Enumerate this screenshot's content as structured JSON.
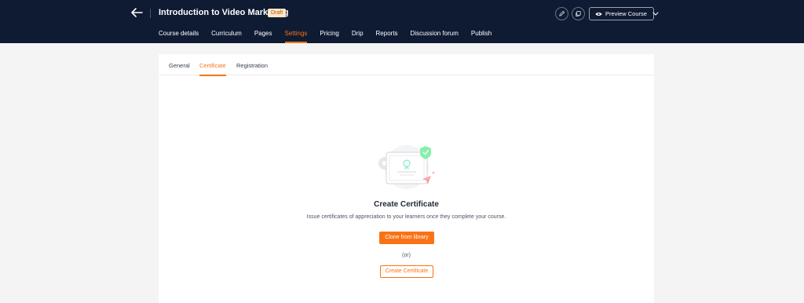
{
  "header": {
    "course_title": "Introduction to Video Marketing",
    "status_badge": "Draft",
    "preview_label": "Preview Course",
    "icons": [
      "back-arrow-icon",
      "pencil-icon",
      "copy-icon",
      "eye-icon",
      "chevron-down-icon"
    ]
  },
  "nav": {
    "items": [
      {
        "label": "Course details"
      },
      {
        "label": "Curriculum"
      },
      {
        "label": "Pages"
      },
      {
        "label": "Settings",
        "active": true
      },
      {
        "label": "Pricing"
      },
      {
        "label": "Drip"
      },
      {
        "label": "Reports"
      },
      {
        "label": "Discussion forum"
      },
      {
        "label": "Publish"
      }
    ]
  },
  "settings_tabs": {
    "items": [
      {
        "label": "General"
      },
      {
        "label": "Certificate",
        "active": true
      },
      {
        "label": "Registration"
      }
    ]
  },
  "empty_state": {
    "title": "Create Certificate",
    "description": "Issue certificates of appreciation to your learners once they complete your course.",
    "primary_button": "Clone from library",
    "or_text": "(or)",
    "secondary_button": "Create Certificate"
  },
  "colors": {
    "header_bg": "#0f1b33",
    "accent": "#f97316",
    "page_bg": "#f4f4f5",
    "card_bg": "#ffffff"
  }
}
